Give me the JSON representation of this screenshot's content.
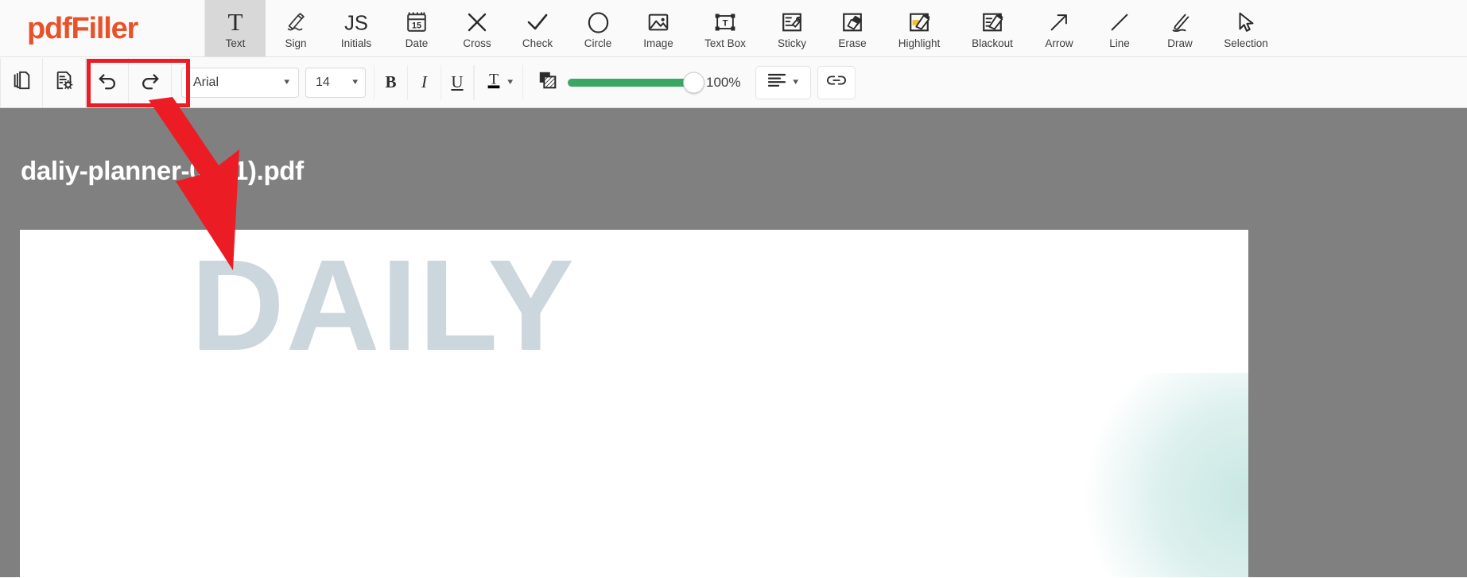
{
  "app": {
    "brand_pdf": "pdf",
    "brand_filler": "Filler",
    "brand_name": "pdfFiller"
  },
  "toolbar_top": {
    "tools": [
      {
        "label": "Text",
        "icon": "text-icon",
        "active": true
      },
      {
        "label": "Sign",
        "icon": "sign-icon",
        "active": false
      },
      {
        "label": "Initials",
        "icon": "initials-icon",
        "active": false
      },
      {
        "label": "Date",
        "icon": "date-icon",
        "active": false
      },
      {
        "label": "Cross",
        "icon": "cross-icon",
        "active": false
      },
      {
        "label": "Check",
        "icon": "check-icon",
        "active": false
      },
      {
        "label": "Circle",
        "icon": "circle-icon",
        "active": false
      },
      {
        "label": "Image",
        "icon": "image-icon",
        "active": false
      },
      {
        "label": "Text Box",
        "icon": "text-box-icon",
        "active": false
      },
      {
        "label": "Sticky",
        "icon": "sticky-icon",
        "active": false
      },
      {
        "label": "Erase",
        "icon": "erase-icon",
        "active": false
      },
      {
        "label": "Highlight",
        "icon": "highlight-icon",
        "active": false
      },
      {
        "label": "Blackout",
        "icon": "blackout-icon",
        "active": false
      },
      {
        "label": "Arrow",
        "icon": "arrow-icon",
        "active": false
      },
      {
        "label": "Line",
        "icon": "line-icon",
        "active": false
      },
      {
        "label": "Draw",
        "icon": "draw-icon",
        "active": false
      },
      {
        "label": "Selection",
        "icon": "selection-icon",
        "active": false
      }
    ],
    "initials_text": "JS",
    "date_day": "15",
    "textbox_letter": "T"
  },
  "toolbar_sub": {
    "pages_icon": "copy-pages-icon",
    "doc_settings_icon": "document-settings-icon",
    "undo_icon": "undo-icon",
    "redo_icon": "redo-icon",
    "font_family": "Arial",
    "font_size": "14",
    "bold_label": "B",
    "italic_label": "I",
    "underline_label": "U",
    "text_color_label": "T",
    "text_color_swatch": "#000000",
    "opacity_icon": "opacity-icon",
    "opacity_value": "100%",
    "opacity_percent": 100,
    "align_icon": "align-left-icon",
    "link_icon": "link-icon",
    "slider_color": "#3aa763"
  },
  "highlight_overlay": {
    "box_color": "#ec1c24",
    "target": "undo-redo-buttons",
    "arrow_color": "#ec1c24"
  },
  "workspace": {
    "document_title": "daliy-planner-03 (1).pdf",
    "background_color": "#808080",
    "page": {
      "watermark_text": "DAILY",
      "watermark_color": "#ccd6dd"
    }
  }
}
